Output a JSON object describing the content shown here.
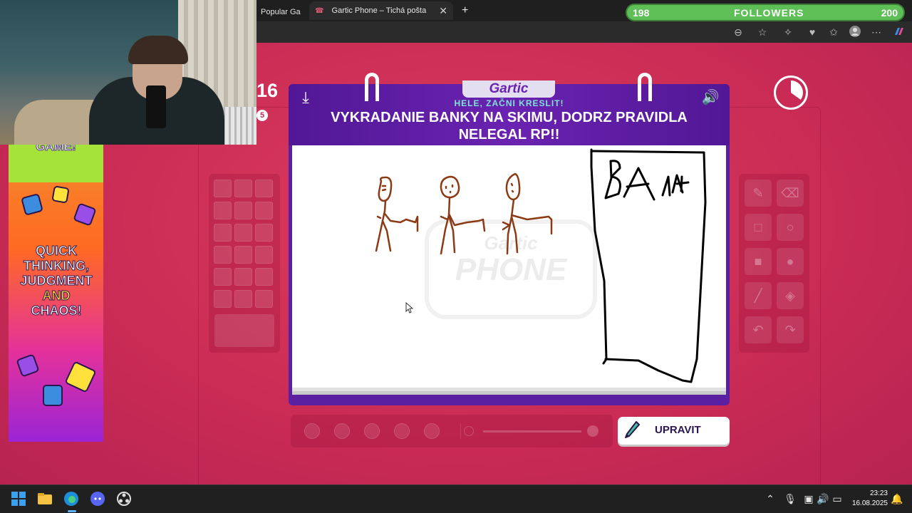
{
  "browser": {
    "tabs": [
      {
        "label": "Popular Ga",
        "close": "✕"
      },
      {
        "label": "Gartic Phone – Tichá pošta",
        "close": "✕"
      }
    ],
    "new_tab": "+",
    "toolbar_icons": [
      "zoom-icon",
      "favorite-star-icon",
      "extensions-icon",
      "browser-essentials-icon",
      "favorites-icon",
      "profile-icon",
      "more-icon",
      "copilot-icon"
    ]
  },
  "overlay": {
    "followers_current": "198",
    "followers_label": "FOLLOWERS",
    "followers_goal": "200",
    "followers_progress": 0.99
  },
  "ad": {
    "top_text": "GAME!",
    "text_line1": "QUICK",
    "text_line2": "THINKING,",
    "text_line3": "JUDGMENT",
    "text_line4": "AND",
    "text_line5": "CHAOS!"
  },
  "game": {
    "round_partial": "16",
    "round_sub_partial": "5",
    "logo": "Gartic",
    "prompt_label": "HELE, ZAČNI KRESLIT!",
    "prompt_line1": "VYKRADANIE BANKY NA SKIMU, DODRZ PRAVIDLA",
    "prompt_line2": "NELEGAL RP!!",
    "watermark_top": "Gartic",
    "watermark_bottom": "PHONE",
    "timer_progress": 0.35,
    "edit_button": "UPRAVIT",
    "tools": [
      "pencil-icon",
      "eraser-icon",
      "rectangle-outline-icon",
      "circle-outline-icon",
      "rectangle-fill-icon",
      "circle-fill-icon",
      "line-icon",
      "bucket-icon",
      "undo-icon",
      "redo-icon"
    ],
    "colors": {
      "accent": "#5b1fa1",
      "prompt_label": "#7ee3d8",
      "drawing_brown": "#8b3a14",
      "background": "#c92b55"
    }
  },
  "taskbar": {
    "time": "23:23",
    "date": "16.08.2025"
  }
}
